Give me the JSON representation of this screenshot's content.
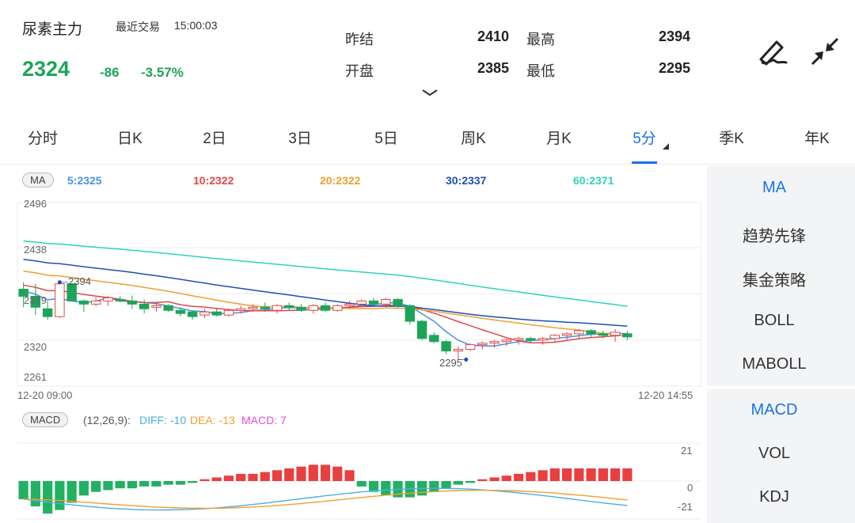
{
  "header": {
    "name": "尿素主力",
    "trade_label": "最近交易",
    "trade_time": "15:00:03",
    "price": "2324",
    "change": "-86",
    "change_pct": "-3.57%",
    "down_color": "#1ea45a",
    "quotes": [
      {
        "label": "昨结",
        "value": "2410"
      },
      {
        "label": "最高",
        "value": "2394"
      },
      {
        "label": "开盘",
        "value": "2385"
      },
      {
        "label": "最低",
        "value": "2295"
      }
    ],
    "icons": [
      "draw-pen-icon",
      "collapse-arrows-icon",
      "chevron-down-icon"
    ]
  },
  "tabs": [
    "分时",
    "日K",
    "2日",
    "3日",
    "5日",
    "周K",
    "月K",
    "5分",
    "季K",
    "年K"
  ],
  "active_tab": "5分",
  "chart": {
    "ma_pill": "MA",
    "ma_labels": [
      {
        "text": "5:2325",
        "color": "#4a90e2"
      },
      {
        "text": "10:2322",
        "color": "#e04848"
      },
      {
        "text": "20:2322",
        "color": "#f0a030"
      },
      {
        "text": "30:2337",
        "color": "#1f4fb5"
      },
      {
        "text": "60:2371",
        "color": "#2dd4b8"
      }
    ],
    "y_labels": [
      "2496",
      "2438",
      "2379",
      "2320",
      "2261"
    ],
    "x_start": "12-20 09:00",
    "x_end": "12-20 14:55",
    "high_marker": "2394",
    "low_marker": "2295",
    "macd_pill": "MACD",
    "macd_params": "(12,26,9):",
    "diff": "DIFF: -10",
    "dea": "DEA: -13",
    "macd": "MACD: 7",
    "macd_y_labels": [
      "21",
      "0",
      "-21"
    ]
  },
  "side_main": [
    "MA",
    "趋势先锋",
    "集金策略",
    "BOLL",
    "MABOLL"
  ],
  "side_sub": [
    "MACD",
    "VOL",
    "KDJ"
  ],
  "chart_data": {
    "type": "candlestick",
    "y_range": [
      2261,
      2496
    ],
    "ohlc": [
      [
        2385,
        2394,
        2362,
        2376
      ],
      [
        2376,
        2392,
        2352,
        2362
      ],
      [
        2360,
        2370,
        2346,
        2350
      ],
      [
        2350,
        2394,
        2348,
        2392
      ],
      [
        2392,
        2393,
        2370,
        2370
      ],
      [
        2370,
        2372,
        2356,
        2366
      ],
      [
        2366,
        2375,
        2363,
        2370
      ],
      [
        2370,
        2376,
        2364,
        2374
      ],
      [
        2372,
        2376,
        2368,
        2370
      ],
      [
        2370,
        2377,
        2360,
        2366
      ],
      [
        2366,
        2372,
        2354,
        2360
      ],
      [
        2362,
        2368,
        2356,
        2364
      ],
      [
        2364,
        2366,
        2356,
        2358
      ],
      [
        2358,
        2362,
        2350,
        2354
      ],
      [
        2356,
        2358,
        2346,
        2350
      ],
      [
        2352,
        2360,
        2348,
        2356
      ],
      [
        2356,
        2360,
        2350,
        2352
      ],
      [
        2352,
        2360,
        2350,
        2358
      ],
      [
        2358,
        2364,
        2354,
        2360
      ],
      [
        2360,
        2366,
        2356,
        2362
      ],
      [
        2362,
        2368,
        2356,
        2360
      ],
      [
        2358,
        2366,
        2354,
        2364
      ],
      [
        2364,
        2368,
        2358,
        2362
      ],
      [
        2362,
        2366,
        2356,
        2358
      ],
      [
        2358,
        2366,
        2354,
        2364
      ],
      [
        2364,
        2368,
        2356,
        2358
      ],
      [
        2358,
        2366,
        2356,
        2364
      ],
      [
        2364,
        2370,
        2360,
        2366
      ],
      [
        2366,
        2372,
        2362,
        2370
      ],
      [
        2370,
        2374,
        2364,
        2366
      ],
      [
        2366,
        2374,
        2364,
        2372
      ],
      [
        2372,
        2374,
        2362,
        2364
      ],
      [
        2364,
        2366,
        2340,
        2344
      ],
      [
        2344,
        2346,
        2320,
        2322
      ],
      [
        2326,
        2330,
        2316,
        2318
      ],
      [
        2318,
        2320,
        2302,
        2306
      ],
      [
        2306,
        2312,
        2295,
        2308
      ],
      [
        2308,
        2316,
        2306,
        2314
      ],
      [
        2314,
        2318,
        2308,
        2316
      ],
      [
        2316,
        2320,
        2310,
        2318
      ],
      [
        2318,
        2322,
        2312,
        2320
      ],
      [
        2320,
        2324,
        2314,
        2322
      ],
      [
        2322,
        2324,
        2316,
        2320
      ],
      [
        2320,
        2324,
        2314,
        2322
      ],
      [
        2322,
        2328,
        2318,
        2326
      ],
      [
        2326,
        2330,
        2320,
        2328
      ],
      [
        2328,
        2334,
        2322,
        2332
      ],
      [
        2332,
        2334,
        2324,
        2328
      ],
      [
        2328,
        2332,
        2322,
        2326
      ],
      [
        2326,
        2334,
        2318,
        2330
      ],
      [
        2328,
        2332,
        2320,
        2324
      ]
    ],
    "ma5_end": 2325,
    "ma10_end": 2322,
    "ma20_end": 2322,
    "ma30_end": 2337,
    "ma60_end": 2371,
    "macd_hist": [
      -10,
      -14,
      -18,
      -16,
      -12,
      -8,
      -6,
      -5,
      -4,
      -4,
      -3,
      -3,
      -2,
      -2,
      -1,
      1,
      2,
      3,
      4,
      4,
      5,
      6,
      7,
      8,
      9,
      9,
      8,
      6,
      -3,
      -6,
      -8,
      -9,
      -9,
      -8,
      -6,
      -4,
      -2,
      -1,
      1,
      2,
      3,
      4,
      5,
      6,
      7,
      7,
      7,
      7,
      7,
      7,
      7
    ],
    "macd_range": [
      -21,
      21
    ]
  }
}
